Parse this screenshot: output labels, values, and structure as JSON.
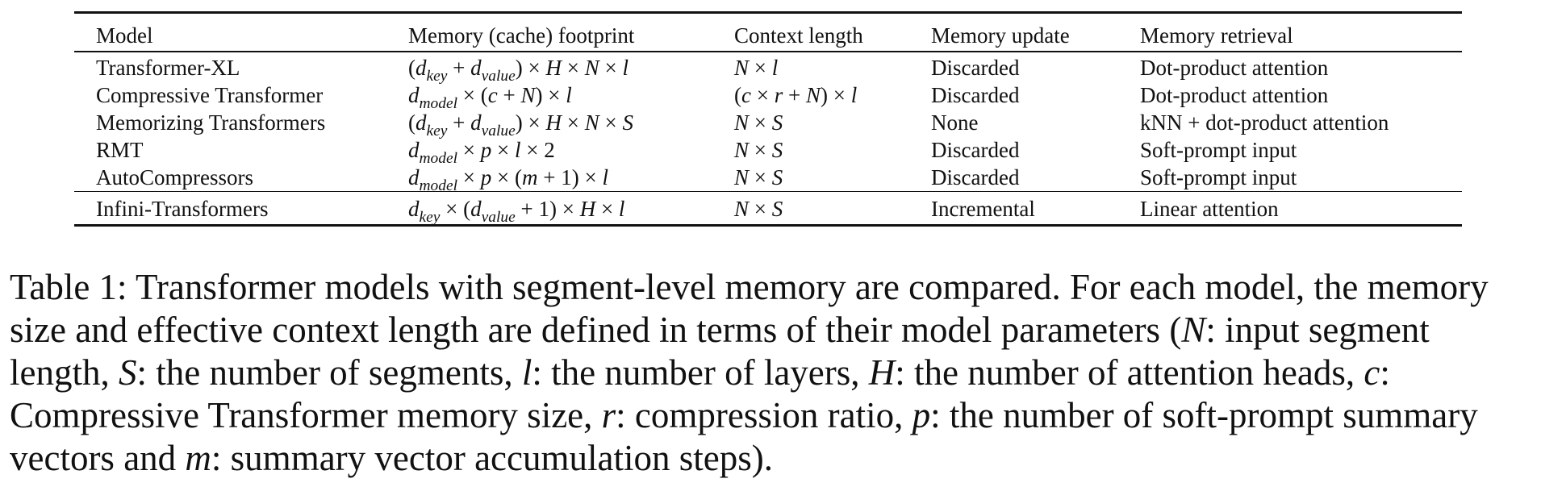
{
  "table": {
    "headers": [
      "Model",
      "Memory (cache) footprint",
      "Context length",
      "Memory update",
      "Memory retrieval"
    ],
    "rows": [
      {
        "model": "Transformer-XL",
        "footprint": "(d_key + d_value) × H × N × l",
        "context": "N × l",
        "update": "Discarded",
        "retrieval": "Dot-product attention"
      },
      {
        "model": "Compressive Transformer",
        "footprint": "d_model × (c + N) × l",
        "context": "(c × r + N) × l",
        "update": "Discarded",
        "retrieval": "Dot-product attention"
      },
      {
        "model": "Memorizing Transformers",
        "footprint": "(d_key + d_value) × H × N × S",
        "context": "N × S",
        "update": "None",
        "retrieval": "kNN + dot-product attention"
      },
      {
        "model": "RMT",
        "footprint": "d_model × p × l × 2",
        "context": "N × S",
        "update": "Discarded",
        "retrieval": "Soft-prompt input"
      },
      {
        "model": "AutoCompressors",
        "footprint": "d_model × p × (m + 1) × l",
        "context": "N × S",
        "update": "Discarded",
        "retrieval": "Soft-prompt input"
      },
      {
        "model": "Infini-Transformers",
        "footprint": "d_key × (d_value + 1) × H × l",
        "context": "N × S",
        "update": "Incremental",
        "retrieval": "Linear attention"
      }
    ]
  },
  "caption": {
    "text": "Table 1: Transformer models with segment-level memory are compared. For each model, the memory size and effective context length are defined in terms of their model parameters (N: input segment length, S: the number of segments, l: the number of layers, H: the number of attention heads, c: Compressive Transformer memory size, r: compression ratio, p: the number of soft-prompt summary vectors and m: summary vector accumulation steps)."
  }
}
